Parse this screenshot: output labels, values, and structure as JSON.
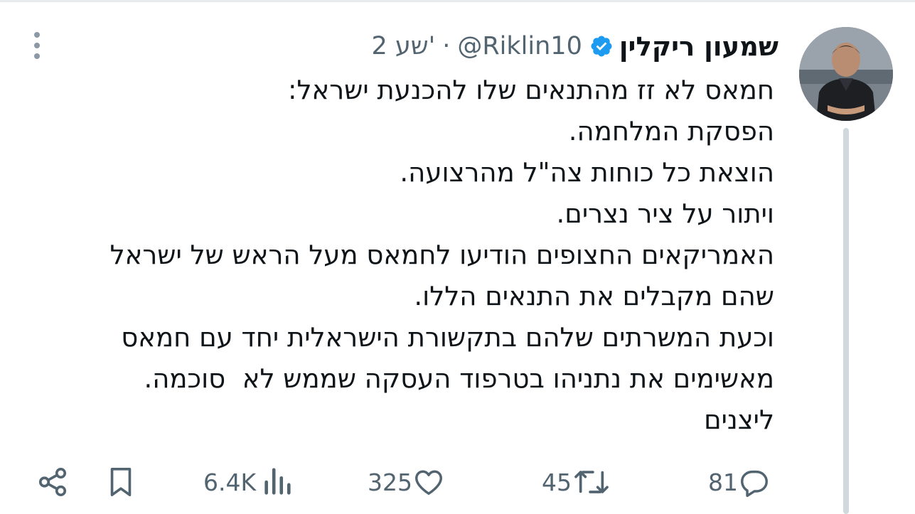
{
  "tweet": {
    "display_name": "שמעון ריקלין",
    "handle": "@Riklin10",
    "separator": "·",
    "time": "2 שע'",
    "lines": [
      "חמאס לא זז מהתנאים שלו להכנעת ישראל:",
      "הפסקת המלחמה.",
      "הוצאת כל כוחות צה\"ל מהרצועה.",
      "ויתור על ציר נצרים.",
      "האמריקאים החצופים הודיעו לחמאס מעל הראש של ישראל",
      "שהם מקבלים את התנאים הללו.",
      "וכעת המשרתים שלהם בתקשורת הישראלית יחד עם חמאס",
      "מאשימים את נתניהו בטרפוד העסקה שממש לא  סוכמה.",
      "ליצנים"
    ]
  },
  "actions": {
    "replies": "81",
    "reposts": "45",
    "likes": "325",
    "views": "6.4K"
  },
  "icons": {
    "verified": "verified-badge-icon",
    "reply": "reply-icon",
    "repost": "repost-icon",
    "like": "heart-icon",
    "views": "analytics-icon",
    "bookmark": "bookmark-icon",
    "share": "share-icon",
    "more": "more-vertical-icon"
  },
  "colors": {
    "text": "#0f1419",
    "secondary": "#536471",
    "verified": "#1d9bf0",
    "thread_line": "#cfd9de"
  }
}
